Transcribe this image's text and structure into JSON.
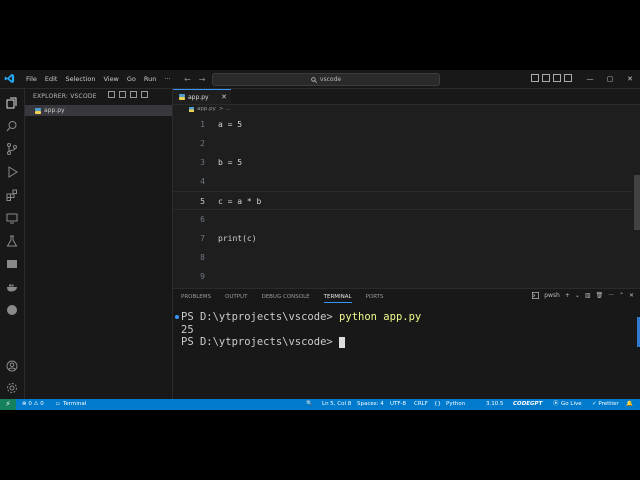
{
  "titlebar": {
    "menu": [
      "File",
      "Edit",
      "Selection",
      "View",
      "Go",
      "Run",
      "···"
    ],
    "back_arrow": "←",
    "forward_arrow": "→",
    "search_text": "vscode",
    "window_controls": [
      "—",
      "▢",
      "✕"
    ]
  },
  "sidebar": {
    "header": "EXPLORER: VSCODE",
    "files": [
      {
        "name": "app.py"
      }
    ]
  },
  "editor": {
    "tab_label": "app.py",
    "tab_close": "✕",
    "breadcrumb_file": "app.py",
    "breadcrumb_more": "> ...",
    "lines": [
      {
        "num": "1",
        "code": "a = 5"
      },
      {
        "num": "2",
        "code": ""
      },
      {
        "num": "3",
        "code": "b = 5"
      },
      {
        "num": "4",
        "code": ""
      },
      {
        "num": "5",
        "code": "c = a * b"
      },
      {
        "num": "6",
        "code": ""
      },
      {
        "num": "7",
        "code": "print(c)"
      },
      {
        "num": "8",
        "code": ""
      },
      {
        "num": "9",
        "code": ""
      }
    ]
  },
  "panel": {
    "tabs": [
      "PROBLEMS",
      "OUTPUT",
      "DEBUG CONSOLE",
      "TERMINAL",
      "PORTS"
    ],
    "active_tab": "TERMINAL",
    "shell": "pwsh",
    "terminal": {
      "prompt": "PS D:\\ytprojects\\vscode> ",
      "command": "python app.py",
      "output": "25",
      "prompt2": "PS D:\\ytprojects\\vscode> "
    }
  },
  "statusbar": {
    "remote_icon": "⚡",
    "problems": "⊗ 0 ⚠ 0",
    "terminal": "Terminal",
    "position": "Ln 5, Col 8",
    "spaces": "Spaces: 4",
    "encoding": "UTF-8",
    "eol": "CRLF",
    "language": "Python",
    "version": "3.10.5",
    "codegpt": "CODEGPT",
    "golive": "Go Live",
    "prettier": "✓ Prettier",
    "notifications": "🔔"
  },
  "colors": {
    "accent": "#007acc",
    "active_tab_border": "#3794ff",
    "python_icon": "#4f9fcf"
  }
}
